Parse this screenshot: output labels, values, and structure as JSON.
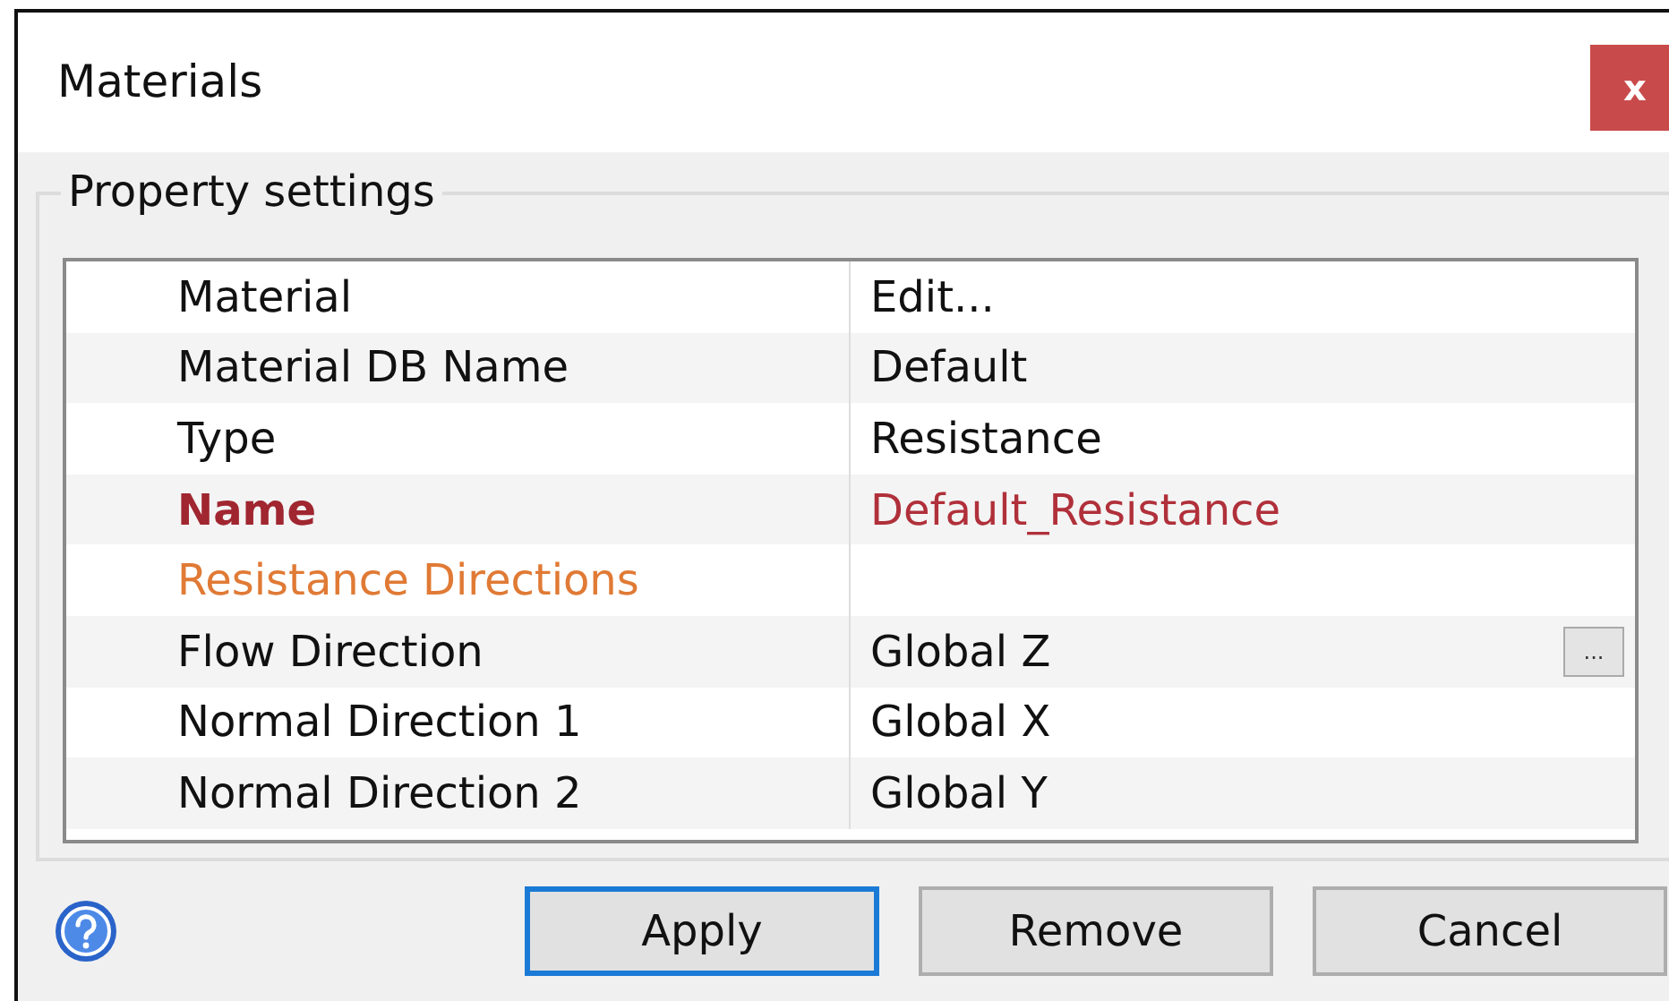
{
  "window": {
    "title": "Materials",
    "close": "x"
  },
  "group": {
    "title": "Property settings"
  },
  "properties": [
    {
      "kind": "normal",
      "label": "Material",
      "value": "Edit..."
    },
    {
      "kind": "normal",
      "label": "Material DB Name",
      "value": "Default"
    },
    {
      "kind": "normal",
      "label": "Type",
      "value": "Resistance"
    },
    {
      "kind": "highlight",
      "label": "Name",
      "value": "Default_Resistance"
    },
    {
      "kind": "category",
      "label": "Resistance Directions"
    },
    {
      "kind": "normal",
      "label": "Flow Direction",
      "value": "Global Z",
      "button": "..."
    },
    {
      "kind": "normal",
      "label": "Normal Direction 1",
      "value": "Global X"
    },
    {
      "kind": "normal",
      "label": "Normal Direction 2",
      "value": "Global Y"
    }
  ],
  "buttons": [
    {
      "label": "Apply",
      "focused": true
    },
    {
      "label": "Remove",
      "focused": false
    },
    {
      "label": "Cancel",
      "focused": false
    }
  ]
}
